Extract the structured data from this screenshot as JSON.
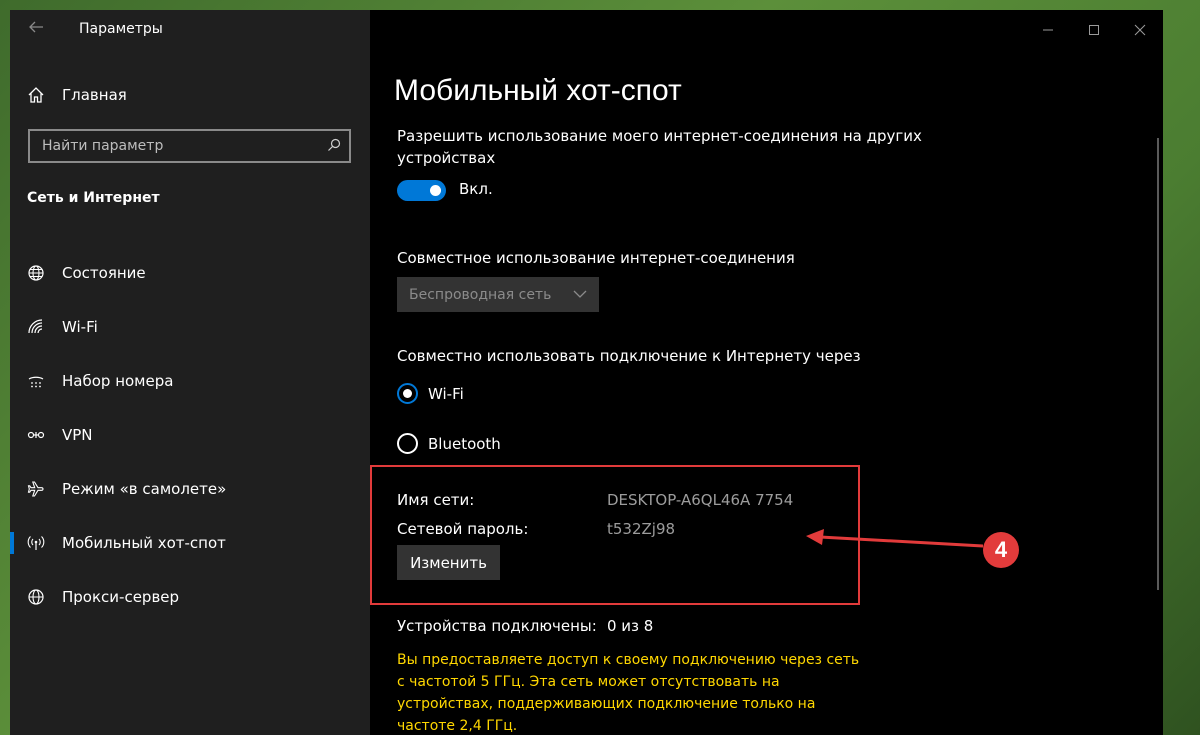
{
  "window": {
    "title": "Параметры"
  },
  "sidebar": {
    "home_label": "Главная",
    "search_placeholder": "Найти параметр",
    "section_title": "Сеть и Интернет",
    "items": [
      {
        "label": "Состояние",
        "icon": "globe-status-icon"
      },
      {
        "label": "Wi-Fi",
        "icon": "wifi-icon"
      },
      {
        "label": "Набор номера",
        "icon": "dialup-icon"
      },
      {
        "label": "VPN",
        "icon": "vpn-icon"
      },
      {
        "label": "Режим «в самолете»",
        "icon": "airplane-icon"
      },
      {
        "label": "Мобильный хот-спот",
        "icon": "hotspot-icon",
        "active": true
      },
      {
        "label": "Прокси-сервер",
        "icon": "globe-icon"
      }
    ]
  },
  "content": {
    "page_title": "Мобильный хот-спот",
    "share_label_line1": "Разрешить использование моего интернет-соединения на других",
    "share_label_line2": "устройствах",
    "toggle_state": "Вкл.",
    "connection_label": "Совместное использование интернет-соединения",
    "connection_selected": "Беспроводная сеть",
    "share_via_label": "Совместно использовать подключение к Интернету через",
    "radio_options": [
      {
        "label": "Wi-Fi",
        "selected": true
      },
      {
        "label": "Bluetooth",
        "selected": false
      }
    ],
    "network_name_key": "Имя сети:",
    "network_name_value": "DESKTOP-A6QL46A 7754",
    "network_password_key": "Сетевой пароль:",
    "network_password_value": "t532Zj98",
    "change_button": "Изменить",
    "devices_key": "Устройства подключены:",
    "devices_value": "0 из 8",
    "warning_text": "Вы предоставляете доступ к своему подключению через сеть с частотой 5 ГГц. Эта сеть может отсутствовать на устройствах, поддерживающих подключение только на частоте 2,4 ГГц."
  },
  "annotation": {
    "badge": "4",
    "color": "#e23b3b"
  },
  "colors": {
    "accent": "#0078d7",
    "warning": "#ffd700"
  }
}
